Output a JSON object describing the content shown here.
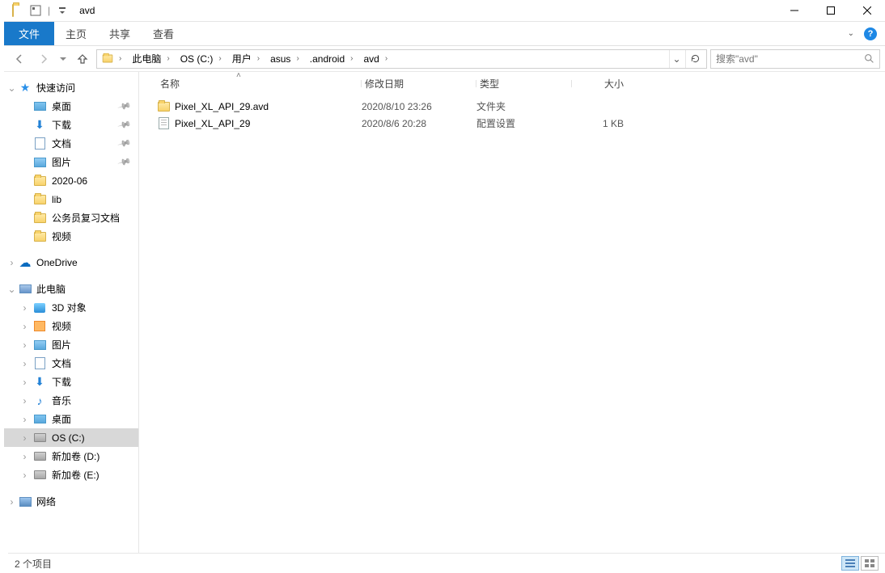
{
  "window": {
    "title": "avd"
  },
  "ribbon": {
    "file": "文件",
    "tabs": [
      "主页",
      "共享",
      "查看"
    ]
  },
  "breadcrumb": {
    "items": [
      "此电脑",
      "OS (C:)",
      "用户",
      "asus",
      ".android",
      "avd"
    ]
  },
  "search": {
    "placeholder": "搜索\"avd\""
  },
  "navpane": {
    "quick_access": {
      "label": "快速访问",
      "items": [
        {
          "label": "桌面",
          "pinned": true
        },
        {
          "label": "下载",
          "pinned": true
        },
        {
          "label": "文档",
          "pinned": true
        },
        {
          "label": "图片",
          "pinned": true
        },
        {
          "label": "2020-06",
          "pinned": false
        },
        {
          "label": "lib",
          "pinned": false
        },
        {
          "label": "公务员复习文档",
          "pinned": false
        },
        {
          "label": "视频",
          "pinned": false
        }
      ]
    },
    "onedrive": {
      "label": "OneDrive"
    },
    "this_pc": {
      "label": "此电脑",
      "items": [
        {
          "label": "3D 对象"
        },
        {
          "label": "视频"
        },
        {
          "label": "图片"
        },
        {
          "label": "文档"
        },
        {
          "label": "下载"
        },
        {
          "label": "音乐"
        },
        {
          "label": "桌面"
        },
        {
          "label": "OS (C:)",
          "selected": true
        },
        {
          "label": "新加卷 (D:)"
        },
        {
          "label": "新加卷 (E:)"
        }
      ]
    },
    "network": {
      "label": "网络"
    }
  },
  "columns": {
    "name": "名称",
    "date": "修改日期",
    "type": "类型",
    "size": "大小"
  },
  "files": [
    {
      "name": "Pixel_XL_API_29.avd",
      "date": "2020/8/10 23:26",
      "type": "文件夹",
      "size": "",
      "icon": "folder"
    },
    {
      "name": "Pixel_XL_API_29",
      "date": "2020/8/6 20:28",
      "type": "配置设置",
      "size": "1 KB",
      "icon": "file"
    }
  ],
  "status": {
    "count_label": "2 个项目"
  }
}
